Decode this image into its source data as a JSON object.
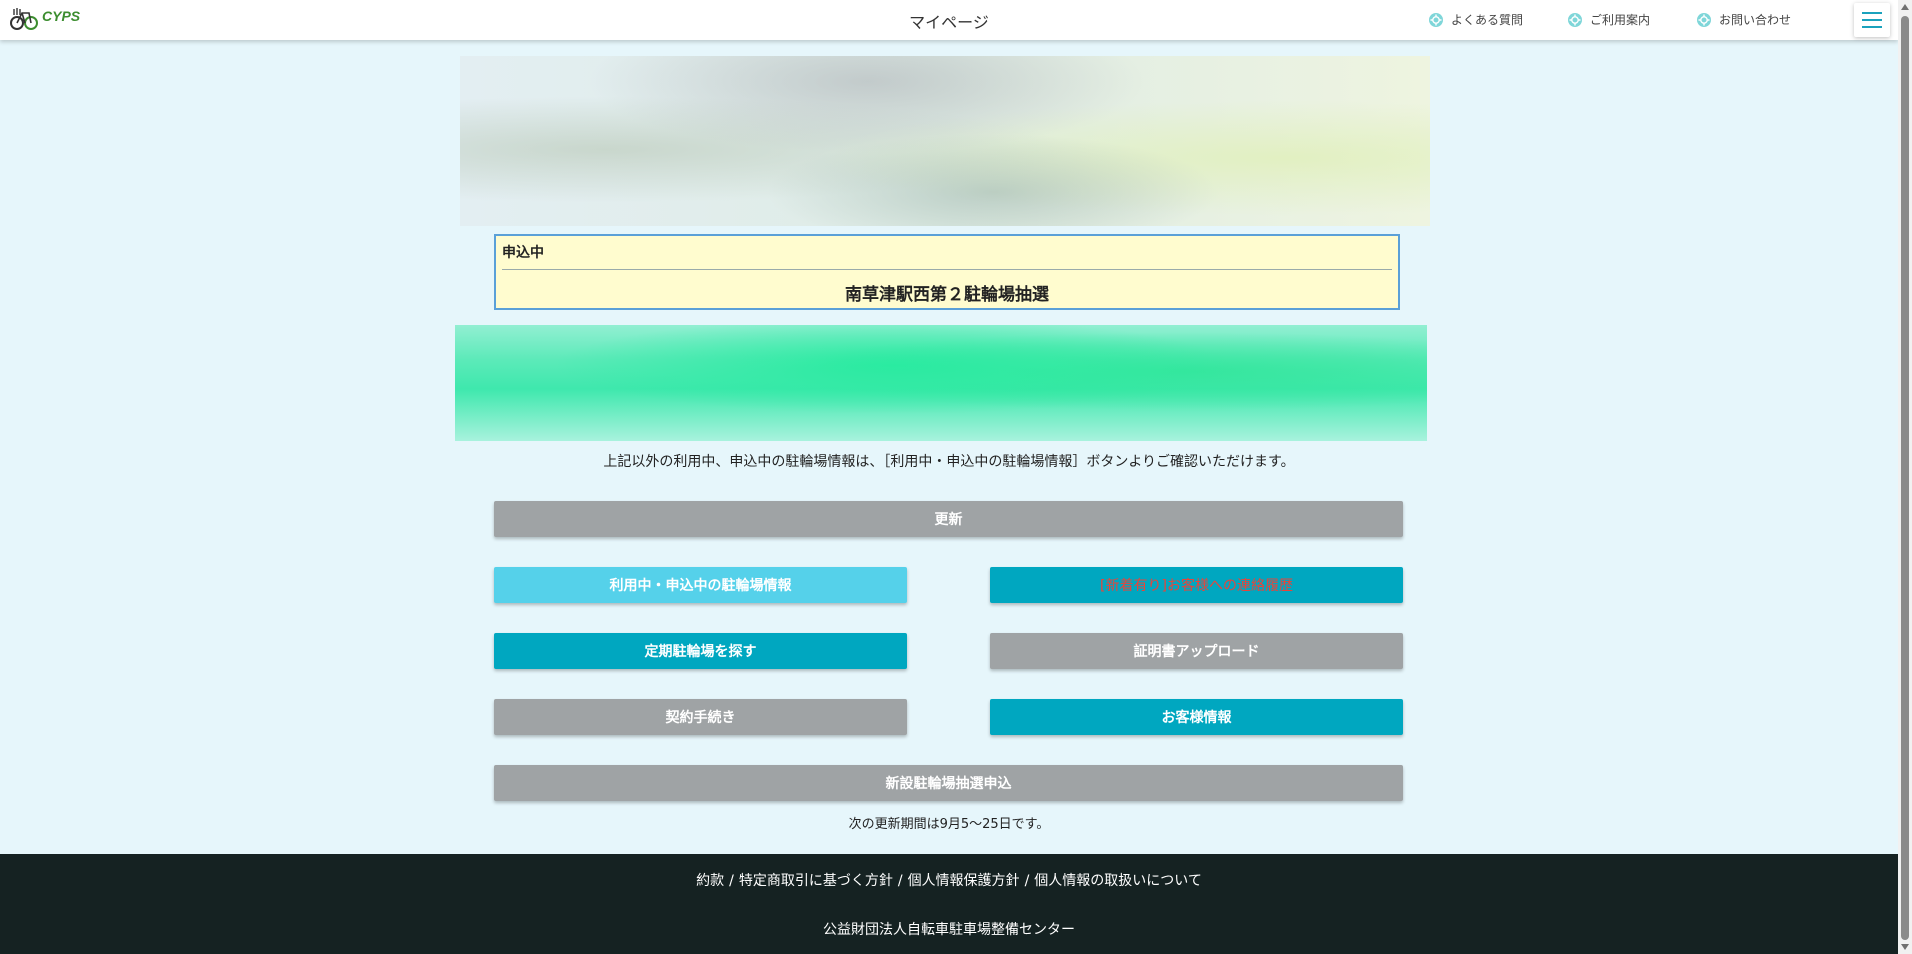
{
  "header": {
    "logo_text": "CYPS",
    "title": "マイページ",
    "links": [
      {
        "label": "よくある質問",
        "icon": "help-gear-icon"
      },
      {
        "label": "ご利用案内",
        "icon": "guide-gear-icon"
      },
      {
        "label": "お問い合わせ",
        "icon": "contact-gear-icon"
      }
    ],
    "menu_icon": "hamburger-menu-icon",
    "accent_color": "#1ba2bd"
  },
  "application": {
    "status": "申込中",
    "name": "南草津駅西第２駐輪場抽選"
  },
  "notice": "上記以外の利用中、申込中の駐輪場情報は、［利用中・申込中の駐輪場情報］ボタンよりご確認いただけます。",
  "buttons": {
    "update": "更新",
    "in_use_info": "利用中・申込中の駐輪場情報",
    "contact_history": "[新着有り]お客様への連絡履歴",
    "search_parking": "定期駐輪場を探す",
    "certificate_upload": "証明書アップロード",
    "contract_procedure": "契約手続き",
    "customer_info": "お客様情報",
    "new_lottery": "新設駐輪場抽選申込"
  },
  "update_note": "次の更新期間は9月5〜25日です。",
  "footer": {
    "links": [
      "約款",
      "特定商取引に基づく方針",
      "個人情報保護方針",
      "個人情報の取扱いについて"
    ],
    "separator": "/",
    "organization": "公益財団法人自転車駐車場整備センター"
  },
  "colors": {
    "background": "#e6f6fb",
    "gray_button": "#9fa3a5",
    "teal_button": "#00a7c0",
    "light_button": "#55d1ea",
    "application_box": "#fffccf",
    "footer": "#152222"
  }
}
